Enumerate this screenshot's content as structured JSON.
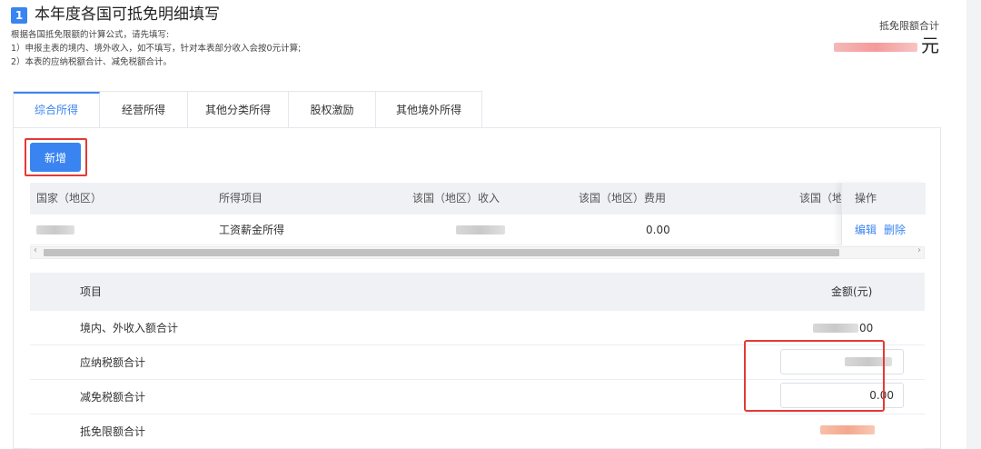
{
  "section": {
    "number": "1",
    "title": "本年度各国可抵免明细填写",
    "desc_lines": [
      "根据各国抵免限额的计算公式，请先填写:",
      "1）申报主表的境内、境外收入，如不填写，针对本表部分收入会按0元计算;",
      "2）本表的应纳税额合计、减免税额合计。"
    ]
  },
  "limit": {
    "label": "抵免限额合计",
    "unit": "元"
  },
  "tabs": [
    {
      "label": "综合所得",
      "active": true
    },
    {
      "label": "经营所得",
      "active": false
    },
    {
      "label": "其他分类所得",
      "active": false
    },
    {
      "label": "股权激励",
      "active": false
    },
    {
      "label": "其他境外所得",
      "active": false
    }
  ],
  "add_button": "新增",
  "income_table": {
    "headers": [
      "国家（地区）",
      "所得项目",
      "该国（地区）收入",
      "该国（地区）费用",
      "该国（地",
      "操作"
    ],
    "rows": [
      {
        "item": "工资薪金所得",
        "expense": "0.00",
        "edit": "编辑",
        "delete": "删除"
      }
    ]
  },
  "summary_table": {
    "headers": [
      "项目",
      "金额(元)"
    ],
    "rows": [
      {
        "label": "境内、外收入额合计",
        "amount_suffix": "00"
      },
      {
        "label": "应纳税额合计"
      },
      {
        "label": "减免税额合计",
        "value": "0.00"
      },
      {
        "label": "抵免限额合计"
      }
    ]
  },
  "colors": {
    "primary": "#3a84f1",
    "highlight": "#e53935"
  }
}
